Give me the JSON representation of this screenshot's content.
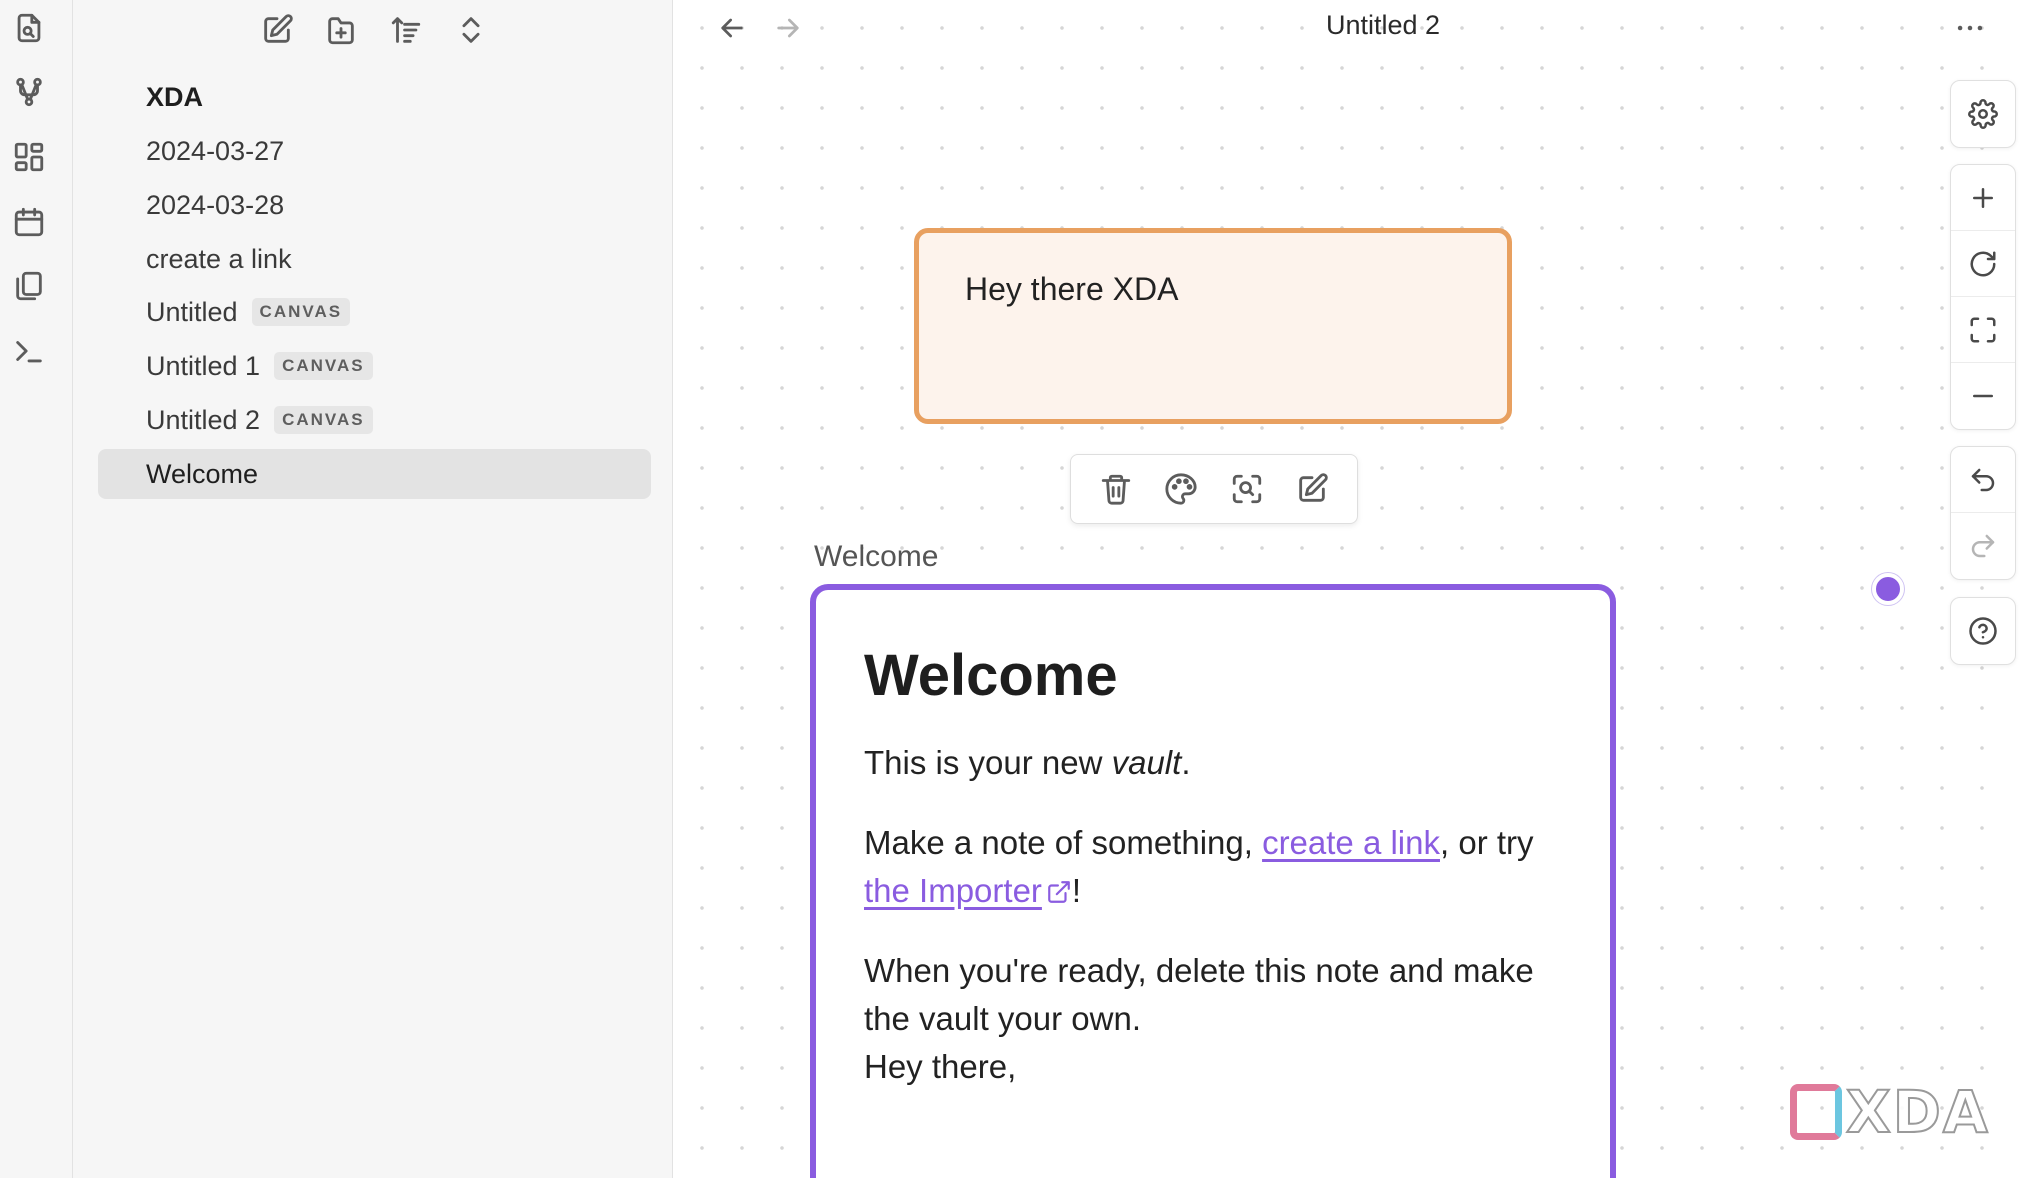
{
  "ribbon": {
    "items": [
      {
        "icon": "search-file-icon"
      },
      {
        "icon": "graph-view-icon"
      },
      {
        "icon": "canvas-layout-icon"
      },
      {
        "icon": "calendar-icon"
      },
      {
        "icon": "copy-files-icon"
      },
      {
        "icon": "terminal-icon"
      }
    ]
  },
  "sidebar": {
    "toolbar": [
      {
        "icon": "new-note-icon"
      },
      {
        "icon": "new-folder-icon"
      },
      {
        "icon": "sort-icon"
      },
      {
        "icon": "collapse-expand-icon"
      }
    ],
    "items": [
      {
        "label": "XDA",
        "badge": "",
        "type": "folder"
      },
      {
        "label": "2024-03-27",
        "badge": ""
      },
      {
        "label": "2024-03-28",
        "badge": ""
      },
      {
        "label": "create a link",
        "badge": ""
      },
      {
        "label": "Untitled",
        "badge": "CANVAS"
      },
      {
        "label": "Untitled 1",
        "badge": "CANVAS"
      },
      {
        "label": "Untitled 2",
        "badge": "CANVAS"
      },
      {
        "label": "Welcome",
        "badge": "",
        "active": true
      }
    ]
  },
  "header": {
    "title": "Untitled 2",
    "back_icon": "arrow-left-icon",
    "forward_icon": "arrow-right-icon",
    "more_icon": "more-options-icon"
  },
  "canvas": {
    "text_card": {
      "text": "Hey there XDA",
      "color": "#e8a060"
    },
    "toolbar": [
      "trash-icon",
      "palette-icon",
      "zoom-to-selection-icon",
      "edit-icon"
    ],
    "note_card": {
      "label": "Welcome",
      "color": "#8a5ce0",
      "title": "Welcome",
      "p1_before": "This is your new ",
      "p1_em": "vault",
      "p1_after": ".",
      "p2_before": "Make a note of something, ",
      "p2_link1": "create a link",
      "p2_mid": ", or try",
      "p2_link2": "the Importer",
      "p2_after": "!",
      "p3_line1": "When you're ready, delete this note and make the vault your own.",
      "p3_line2": "Hey there,"
    }
  },
  "controls": {
    "group1": [
      "settings-icon"
    ],
    "group2": [
      "zoom-in-icon",
      "reset-zoom-icon",
      "fit-to-screen-icon",
      "zoom-out-icon"
    ],
    "group3": [
      "undo-icon",
      "redo-icon"
    ],
    "group4": [
      "help-icon"
    ]
  },
  "watermark": {
    "text": "XDA"
  }
}
